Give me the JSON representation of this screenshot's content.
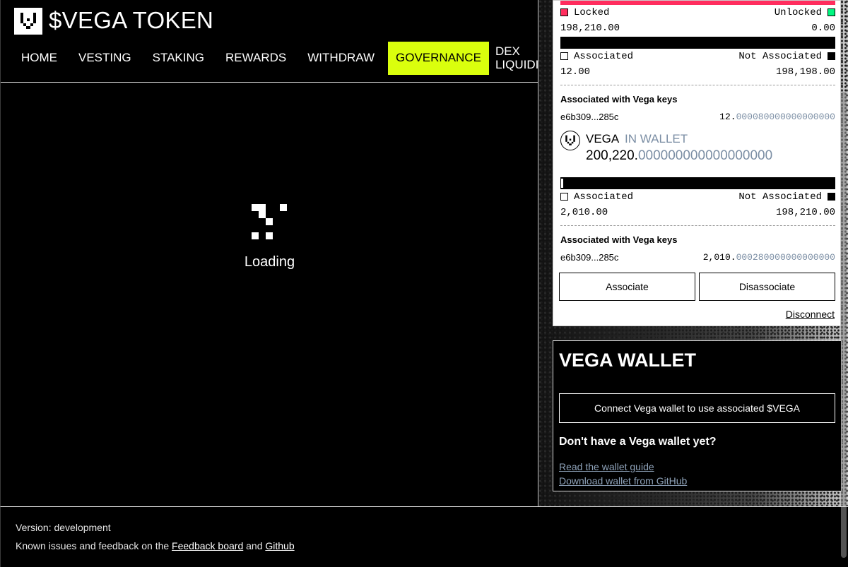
{
  "brand": {
    "title": "$VEGA TOKEN"
  },
  "nav": {
    "items": [
      "HOME",
      "VESTING",
      "STAKING",
      "REWARDS",
      "WITHDRAW",
      "GOVERNANCE",
      "DEX LIQUIDITY"
    ],
    "active": "GOVERNANCE"
  },
  "main": {
    "loading": "Loading"
  },
  "token": {
    "locked_label": "Locked",
    "unlocked_label": "Unlocked",
    "locked_value": "198,210.00",
    "unlocked_value": "0.00",
    "associated_label": "Associated",
    "not_associated_label": "Not Associated",
    "assoc1": "12.00",
    "not_assoc1": "198,198.00",
    "keys_heading": "Associated with Vega keys",
    "key1": "e6b309...285c",
    "key1_amount_int": "12.",
    "key1_amount_dec": "000080000000000000",
    "wallet_token": "VEGA",
    "wallet_badge": "IN WALLET",
    "wallet_amount_int": "200,220.",
    "wallet_amount_dec": "000000000000000000",
    "assoc2": "2,010.00",
    "not_assoc2": "198,210.00",
    "key2": "e6b309...285c",
    "key2_amount_int": "2,010.",
    "key2_amount_dec": "000280000000000000",
    "associate_btn": "Associate",
    "disassociate_btn": "Disassociate",
    "disconnect": "Disconnect"
  },
  "vega_wallet": {
    "title": "VEGA WALLET",
    "connect_btn": "Connect Vega wallet to use associated $VEGA",
    "question": "Don't have a Vega wallet yet?",
    "guide_link": "Read the wallet guide",
    "download_link": "Download wallet from GitHub"
  },
  "footer": {
    "version": "Version: development",
    "known_prefix": "Known issues and feedback on the",
    "feedback_link": "Feedback board",
    "and": "and",
    "github_link": "Github"
  },
  "colors": {
    "accent": "#daff0d",
    "locked": "#ff2d5e",
    "unlocked": "#00f780",
    "dim": "#7b8ea4"
  },
  "icons": [
    "vega-logo-icon",
    "loading-spinner-icon"
  ]
}
